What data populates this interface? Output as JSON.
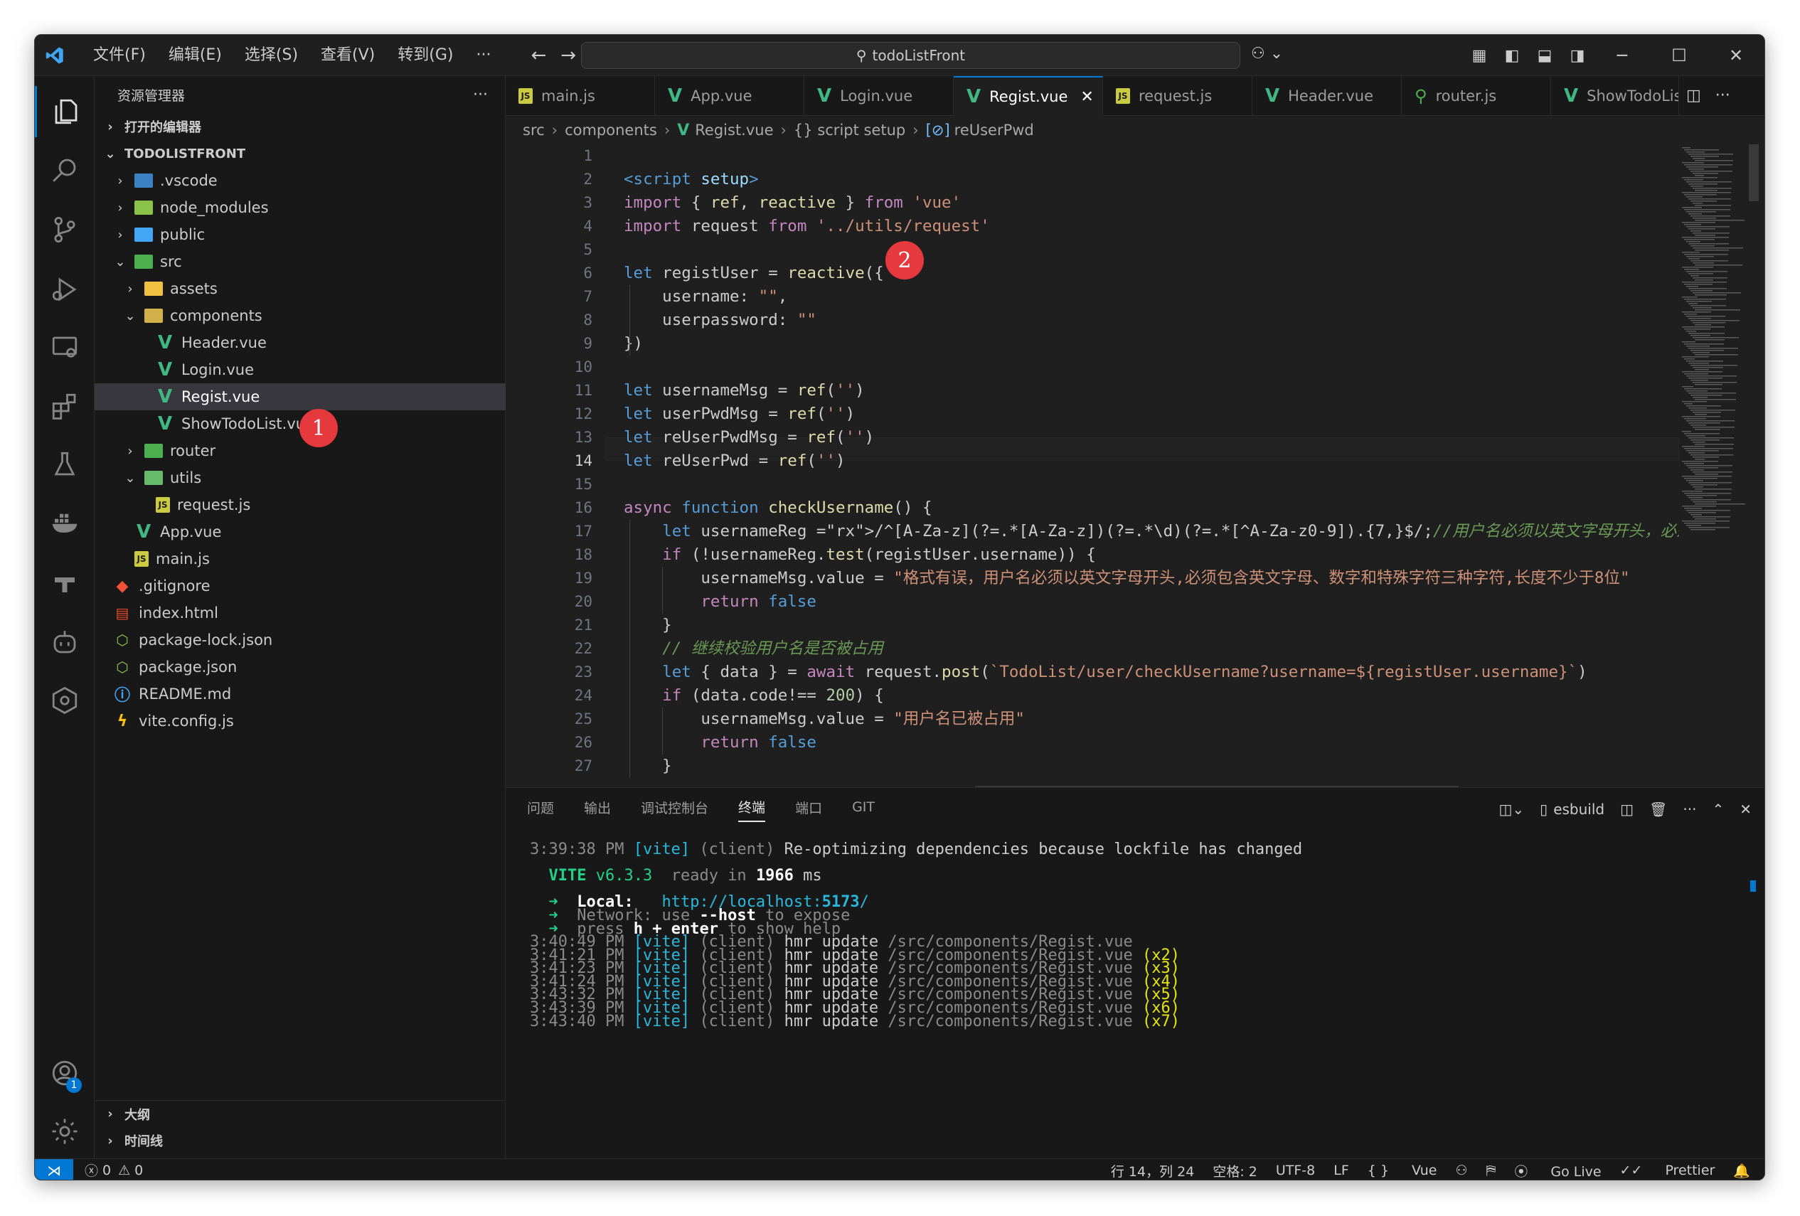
{
  "titlebar": {
    "menus": [
      "文件(F)",
      "编辑(E)",
      "选择(S)",
      "查看(V)",
      "转到(G)",
      "···"
    ],
    "search": "todoListFront"
  },
  "sidebar": {
    "title": "资源管理器",
    "open_editors": "打开的编辑器",
    "project": "TODOLISTFRONT",
    "tree": [
      ".vscode",
      "node_modules",
      "public",
      "src",
      "assets",
      "components",
      "Header.vue",
      "Login.vue",
      "Regist.vue",
      "ShowTodoList.vue",
      "router",
      "utils",
      "request.js",
      "App.vue",
      "main.js",
      ".gitignore",
      "index.html",
      "package-lock.json",
      "package.json",
      "README.md",
      "vite.config.js"
    ],
    "outline": "大纲",
    "timeline": "时间线"
  },
  "tabs": [
    "main.js",
    "App.vue",
    "Login.vue",
    "Regist.vue",
    "request.js",
    "Header.vue",
    "router.js",
    "ShowTodoLis"
  ],
  "breadcrumb": [
    "src",
    "components",
    "Regist.vue",
    "{} script setup",
    "reUserPwd"
  ],
  "badges": [
    "1",
    "2"
  ],
  "code_lines": [
    "",
    "<script setup>",
    "import { ref, reactive } from 'vue'",
    "import request from '../utils/request'",
    "",
    "let registUser = reactive({",
    "    username: \"\",",
    "    userpassword: \"\"",
    "})",
    "",
    "let usernameMsg = ref('')",
    "let userPwdMsg = ref('')",
    "let reUserPwdMsg = ref('')",
    "let reUserPwd = ref('')",
    "",
    "async function checkUsername() {",
    "    let usernameReg =/^[A-Za-z](?=.*[A-Za-z])(?=.*\\d)(?=.*[^A-Za-z0-9]).{7,}$/;//用户名必须以英文字母开头，必须包含英",
    "    if (!usernameReg.test(registUser.username)) {",
    "        usernameMsg.value = \"格式有误，用户名必须以英文字母开头,必须包含英文字母、数字和特殊字符三种字符,长度不少于8位\"",
    "        return false",
    "    }",
    "    // 继续校验用户名是否被占用",
    "    let { data } = await request.post(`TodoList/user/checkUsername?username=${registUser.username}`)",
    "    if (data.code!== 200) {",
    "        usernameMsg.value = \"用户名已被占用\"",
    "        return false",
    "    }"
  ],
  "panel": {
    "tabs": [
      "问题",
      "输出",
      "调试控制台",
      "终端",
      "端口",
      "GIT"
    ],
    "shell": "esbuild"
  },
  "terminal": [
    "3:39:38 PM [vite] (client) Re-optimizing dependencies because lockfile has changed",
    "",
    "  VITE v6.3.3  ready in 1966 ms",
    "",
    "  ➜  Local:   http://localhost:5173/",
    "  ➜  Network: use --host to expose",
    "  ➜  press h + enter to show help",
    "3:40:49 PM [vite] (client) hmr update /src/components/Regist.vue",
    "3:41:21 PM [vite] (client) hmr update /src/components/Regist.vue (x2)",
    "3:41:23 PM [vite] (client) hmr update /src/components/Regist.vue (x3)",
    "3:41:24 PM [vite] (client) hmr update /src/components/Regist.vue (x4)",
    "3:43:32 PM [vite] (client) hmr update /src/components/Regist.vue (x5)",
    "3:43:39 PM [vite] (client) hmr update /src/components/Regist.vue (x6)",
    "3:43:40 PM [vite] (client) hmr update /src/components/Regist.vue (x7)"
  ],
  "status": {
    "errors": "0",
    "warnings": "0",
    "position": "行 14，列 24",
    "spaces": "空格: 2",
    "encoding": "UTF-8",
    "eol": "LF",
    "language": "Vue",
    "golive": "Go Live",
    "prettier": "Prettier",
    "accounts_badge": "1"
  }
}
